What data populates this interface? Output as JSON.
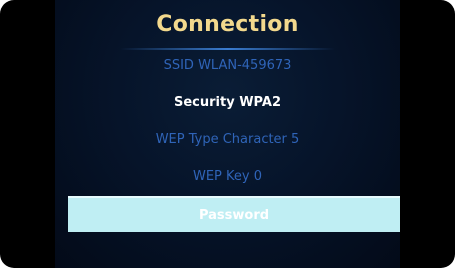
{
  "screen": {
    "title": "Connection",
    "items": [
      {
        "label": "SSID WLAN-459673"
      },
      {
        "label": "Security WPA2"
      },
      {
        "label": "WEP Type Character 5"
      },
      {
        "label": "WEP Key 0"
      },
      {
        "label": "Password"
      }
    ]
  }
}
